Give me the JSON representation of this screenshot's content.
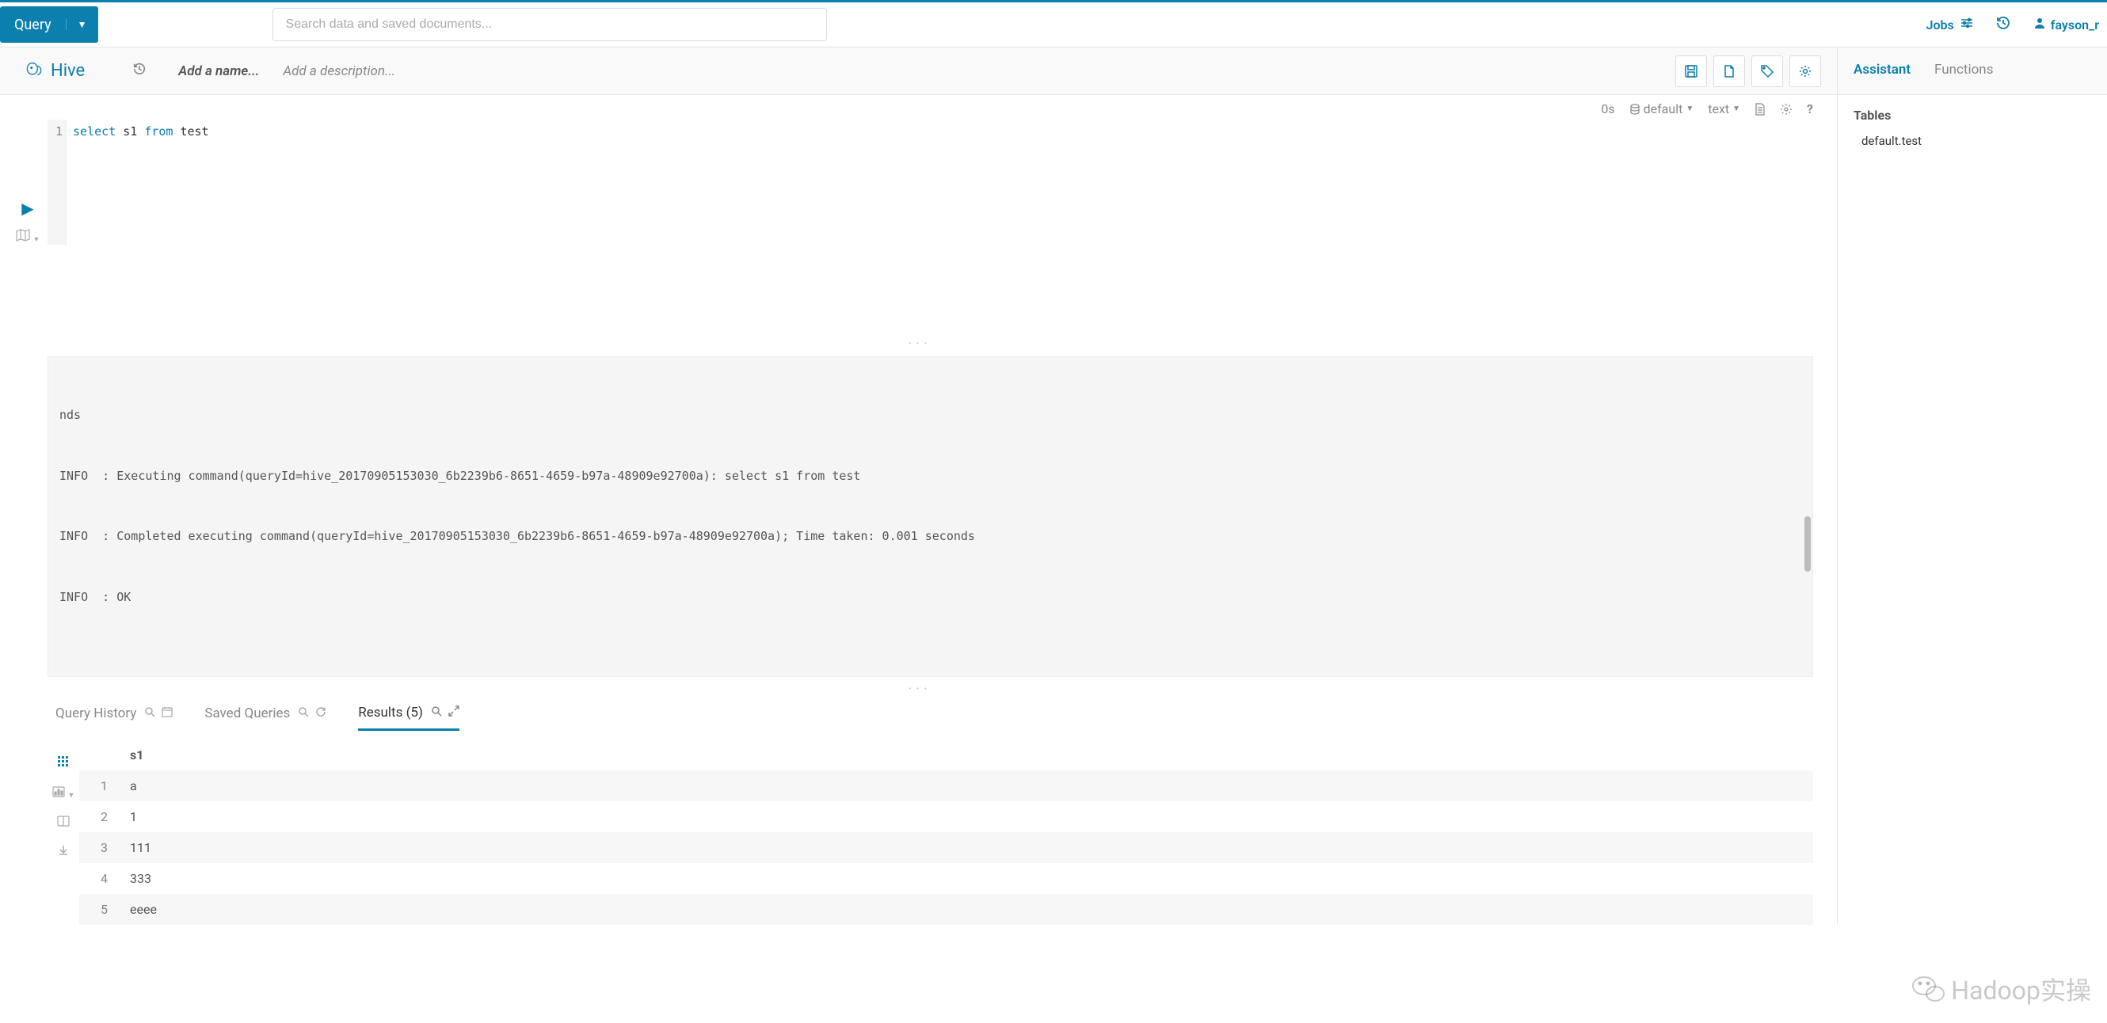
{
  "topbar": {
    "query_label": "Query",
    "search_placeholder": "Search data and saved documents...",
    "jobs_label": "Jobs",
    "username": "fayson_r"
  },
  "editor": {
    "engine": "Hive",
    "name_placeholder": "Add a name...",
    "desc_placeholder": "Add a description...",
    "toolbar": {
      "elapsed": "0s",
      "database": "default",
      "format": "text"
    },
    "code": {
      "line_num": "1",
      "kw1": "select",
      "ident1": " s1 ",
      "kw2": "from",
      "ident2": " test"
    }
  },
  "log": {
    "line1": "nds",
    "line2": "INFO  : Executing command(queryId=hive_20170905153030_6b2239b6-8651-4659-b97a-48909e92700a): select s1 from test",
    "line3": "INFO  : Completed executing command(queryId=hive_20170905153030_6b2239b6-8651-4659-b97a-48909e92700a); Time taken: 0.001 seconds",
    "line4": "INFO  : OK"
  },
  "tabs": {
    "history": "Query History",
    "saved": "Saved Queries",
    "results": "Results (5)"
  },
  "results": {
    "header_col": "s1",
    "rows": [
      {
        "n": "1",
        "v": "a"
      },
      {
        "n": "2",
        "v": "1"
      },
      {
        "n": "3",
        "v": "111"
      },
      {
        "n": "4",
        "v": "333"
      },
      {
        "n": "5",
        "v": "eeee"
      }
    ]
  },
  "right": {
    "tab_assistant": "Assistant",
    "tab_functions": "Functions",
    "tables_header": "Tables",
    "table_item": "default.test"
  },
  "watermark": "Hadoop实操"
}
